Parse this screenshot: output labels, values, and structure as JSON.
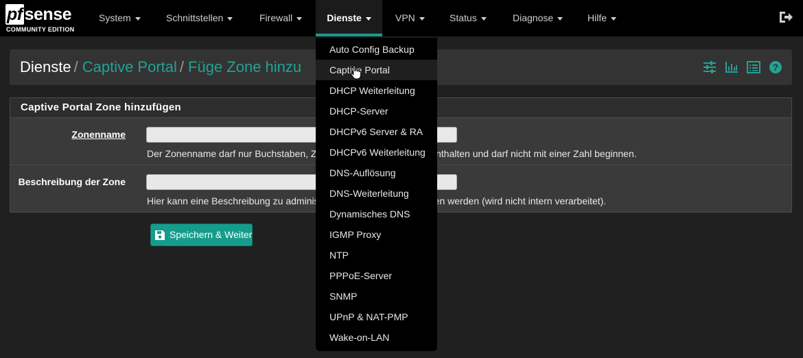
{
  "brand": {
    "name_pf": "pf",
    "name_rest": "sense",
    "edition": "COMMUNITY EDITION"
  },
  "nav": {
    "items": [
      {
        "label": "System"
      },
      {
        "label": "Schnittstellen"
      },
      {
        "label": "Firewall"
      },
      {
        "label": "Dienste",
        "active": true
      },
      {
        "label": "VPN"
      },
      {
        "label": "Status"
      },
      {
        "label": "Diagnose"
      },
      {
        "label": "Hilfe"
      }
    ],
    "logout_icon": "sign-out-icon"
  },
  "breadcrumb": {
    "root": "Dienste",
    "separator": "/",
    "level2": "Captive Portal",
    "level3": "Füge Zone hinzu",
    "icons": [
      "sliders-icon",
      "bar-chart-icon",
      "list-icon",
      "help-icon"
    ]
  },
  "panel": {
    "title": "Captive Portal Zone hinzufügen",
    "fields": [
      {
        "label": "Zonenname",
        "value": "",
        "help": "Der Zonenname darf nur Buchstaben, Zahlen und Unterstriche (_) enthalten und darf nicht mit einer Zahl beginnen."
      },
      {
        "label": "Beschreibung der Zone",
        "value": "",
        "help": "Hier kann eine Beschreibung zu administrativen Zwecken eingetragen werden (wird nicht intern verarbeitet)."
      }
    ]
  },
  "save_button": {
    "label": "Speichern & Weiter",
    "icon": "save-icon"
  },
  "dropdown": {
    "items": [
      "Auto Config Backup",
      "Captive Portal",
      "DHCP Weiterleitung",
      "DHCP-Server",
      "DHCPv6 Server & RA",
      "DHCPv6 Weiterleitung",
      "DNS-Auflösung",
      "DNS-Weiterleitung",
      "Dynamisches DNS",
      "IGMP Proxy",
      "NTP",
      "PPPoE-Server",
      "SNMP",
      "UPnP & NAT-PMP",
      "Wake-on-LAN"
    ],
    "hovered": "Captive Portal"
  },
  "colors": {
    "accent": "#169c8c",
    "link": "#21a394",
    "navbar": "#000000",
    "background": "#202020"
  }
}
